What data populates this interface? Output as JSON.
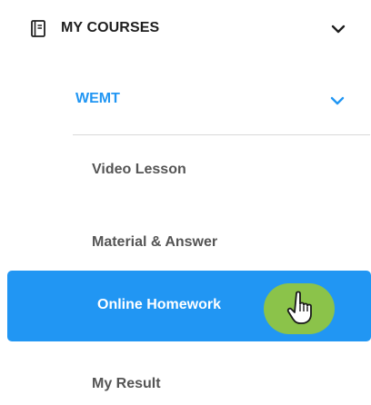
{
  "menu": {
    "my_courses": {
      "label": "MY COURSES",
      "icon": "notebook-icon",
      "chevron": "chevron-down-icon"
    },
    "course": {
      "label": "WEMT",
      "chevron": "chevron-down-icon",
      "accent_color": "#2196f3"
    },
    "items": [
      {
        "label": "Video Lesson",
        "active": false
      },
      {
        "label": "Material & Answer",
        "active": false
      },
      {
        "label": "Online Homework",
        "active": true
      },
      {
        "label": "My Result",
        "active": false
      }
    ],
    "active_color": "#2196f3",
    "cursor": {
      "icon": "hand-pointer-icon",
      "highlight_color": "#8bc34a"
    }
  }
}
